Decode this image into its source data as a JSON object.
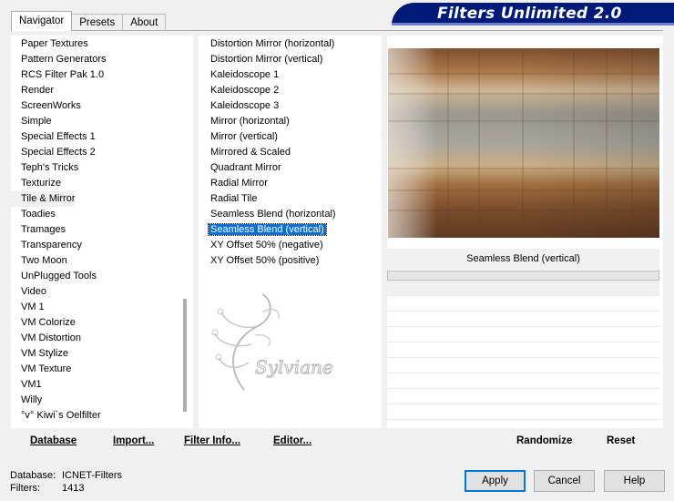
{
  "window": {
    "banner_title": "Filters Unlimited 2.0"
  },
  "tabs": [
    {
      "label": "Navigator",
      "active": true
    },
    {
      "label": "Presets",
      "active": false
    },
    {
      "label": "About",
      "active": false
    }
  ],
  "categories": {
    "selected": "Tile & Mirror",
    "items": [
      "Paper Textures",
      "Pattern Generators",
      "RCS Filter Pak 1.0",
      "Render",
      "ScreenWorks",
      "Simple",
      "Special Effects 1",
      "Special Effects 2",
      "Teph's Tricks",
      "Texturize",
      "Tile & Mirror",
      "Toadies",
      "Tramages",
      "Transparency",
      "Two Moon",
      "UnPlugged Tools",
      "Video",
      "VM 1",
      "VM Colorize",
      "VM Distortion",
      "VM Stylize",
      "VM Texture",
      "VM1",
      "Willy",
      "°v° Kiwi`s Oelfilter"
    ]
  },
  "filters": {
    "selected": "Seamless Blend (vertical)",
    "items": [
      "Distortion Mirror (horizontal)",
      "Distortion Mirror (vertical)",
      "Kaleidoscope 1",
      "Kaleidoscope 2",
      "Kaleidoscope 3",
      "Mirror (horizontal)",
      "Mirror (vertical)",
      "Mirrored & Scaled",
      "Quadrant Mirror",
      "Radial Mirror",
      "Radial Tile",
      "Seamless Blend (horizontal)",
      "Seamless Blend (vertical)",
      "XY Offset 50% (negative)",
      "XY Offset 50% (positive)"
    ]
  },
  "watermark": {
    "text": "Sylviane"
  },
  "preview": {
    "filter_name": "Seamless Blend (vertical)",
    "colors": {
      "dark_brown": "#6b4528",
      "copper": "#b07a48",
      "tan": "#d8b890",
      "gray": "#8f8e88",
      "light": "#d7d2c8"
    }
  },
  "toolbar": {
    "database": "Database",
    "import": "Import...",
    "filter_info": "Filter Info...",
    "editor": "Editor...",
    "randomize": "Randomize",
    "reset": "Reset"
  },
  "status": {
    "database_label": "Database:",
    "database_value": "ICNET-Filters",
    "filters_label": "Filters:",
    "filters_value": "1413"
  },
  "buttons": {
    "apply": "Apply",
    "cancel": "Cancel",
    "help": "Help"
  },
  "colors": {
    "banner": "#001a7a",
    "selection": "#0b6fd3"
  }
}
